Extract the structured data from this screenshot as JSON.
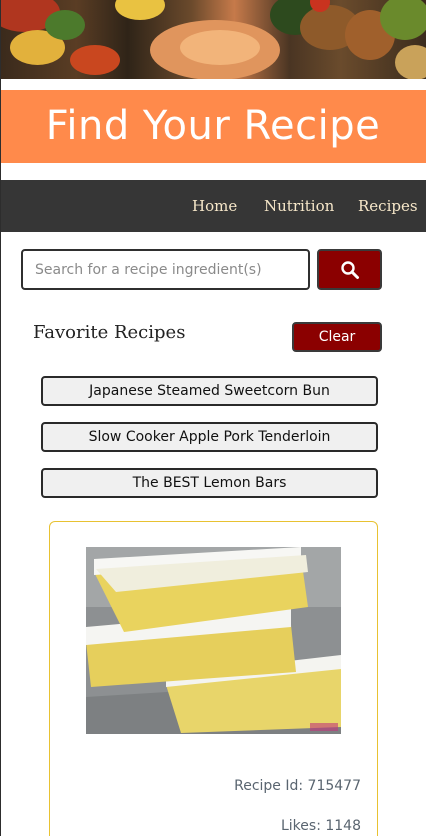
{
  "header": {
    "title": "Find Your Recipe",
    "banner_color": "#ff8a4b"
  },
  "nav": {
    "items": [
      {
        "label": "Home"
      },
      {
        "label": "Nutrition"
      },
      {
        "label": "Recipes"
      }
    ],
    "text_color": "#f6e7c9",
    "bg_color": "#363636"
  },
  "search": {
    "placeholder": "Search for a recipe ingredient(s)",
    "value": "",
    "button_icon": "search-icon",
    "button_color": "#8b0000"
  },
  "favorites": {
    "title": "Favorite Recipes",
    "clear_label": "Clear",
    "items": [
      {
        "label": "Japanese Steamed Sweetcorn Bun"
      },
      {
        "label": "Slow Cooker Apple Pork Tenderloin"
      },
      {
        "label": "The BEST Lemon Bars"
      }
    ]
  },
  "recipe_card": {
    "recipe_id": "Recipe Id: 715477",
    "likes": "Likes: 1148",
    "border_color": "#e8c232"
  }
}
